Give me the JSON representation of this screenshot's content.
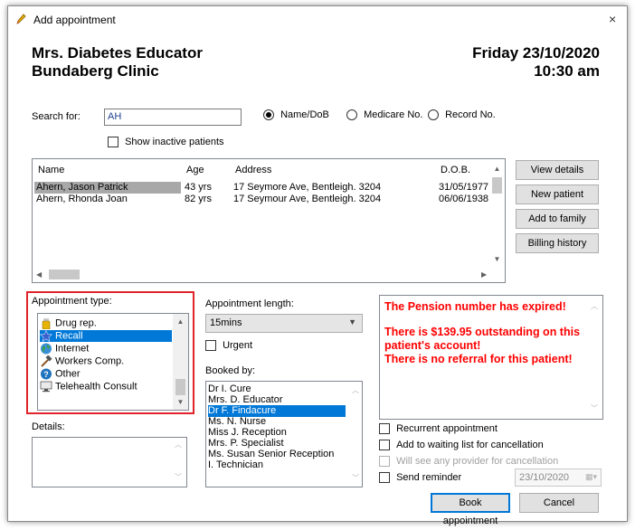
{
  "window": {
    "title": "Add appointment",
    "close_glyph": "×"
  },
  "header": {
    "practitioner": "Mrs. Diabetes Educator",
    "clinic": "Bundaberg Clinic",
    "date": "Friday 23/10/2020",
    "time": "10:30 am"
  },
  "search": {
    "label": "Search for:",
    "value": "AH",
    "show_inactive_label": "Show inactive patients",
    "options": [
      "Name/DoB",
      "Medicare No.",
      "Record No."
    ],
    "selected": "Name/DoB"
  },
  "patients": {
    "columns": [
      "Name",
      "Age",
      "Address",
      "D.O.B."
    ],
    "rows": [
      {
        "name": "Ahern, Jason Patrick",
        "age": "43 yrs",
        "address": "17 Seymore Ave, Bentleigh. 3204",
        "dob": "31/05/1977"
      },
      {
        "name": "Ahern, Rhonda Joan",
        "age": "82 yrs",
        "address": "17 Seymour Ave, Bentleigh. 3204",
        "dob": "06/06/1938"
      }
    ]
  },
  "side_buttons": {
    "view_details": "View details",
    "new_patient": "New patient",
    "add_to_family": "Add to family",
    "billing_history": "Billing history"
  },
  "appointment_type": {
    "label": "Appointment type:",
    "items": [
      {
        "label": "Drug rep.",
        "icon": "pill-bottle-icon",
        "color": "#d4a017"
      },
      {
        "label": "Recall",
        "icon": "star-icon",
        "color": "#3a5fcd"
      },
      {
        "label": "Internet",
        "icon": "globe-icon",
        "color": "#2e8b57"
      },
      {
        "label": "Workers Comp.",
        "icon": "hammer-icon",
        "color": "#8b5a2b"
      },
      {
        "label": "Other",
        "icon": "question-icon",
        "color": "#1e73be"
      },
      {
        "label": "Telehealth Consult",
        "icon": "monitor-icon",
        "color": "#555555"
      }
    ],
    "selected": "Recall"
  },
  "details": {
    "label": "Details:",
    "value": ""
  },
  "length": {
    "label": "Appointment length:",
    "value": "15mins"
  },
  "urgent": {
    "label": "Urgent"
  },
  "booked_by": {
    "label": "Booked by:",
    "items": [
      "Dr I. Cure",
      "Mrs. D. Educator",
      "Dr F. Findacure",
      "Ms. N. Nurse",
      "Miss J. Reception",
      "Mrs. P. Specialist",
      "Ms. Susan Senior Reception",
      "I. Technician"
    ],
    "selected": "Dr F. Findacure"
  },
  "alerts": {
    "line1": "The Pension number has expired!",
    "line2": "There is $139.95 outstanding on this patient's account!",
    "line3": "There is no referral for this patient!",
    "color": "#ff0000"
  },
  "options": {
    "recurrent": "Recurrent appointment",
    "waiting_list": "Add to waiting list for cancellation",
    "any_provider": "Will see any provider for cancellation",
    "send_reminder": "Send reminder",
    "reminder_date": "23/10/2020"
  },
  "actions": {
    "book": "Book appointment",
    "cancel": "Cancel"
  },
  "accent": "#0078d7",
  "highlight_border": "#e0242b"
}
